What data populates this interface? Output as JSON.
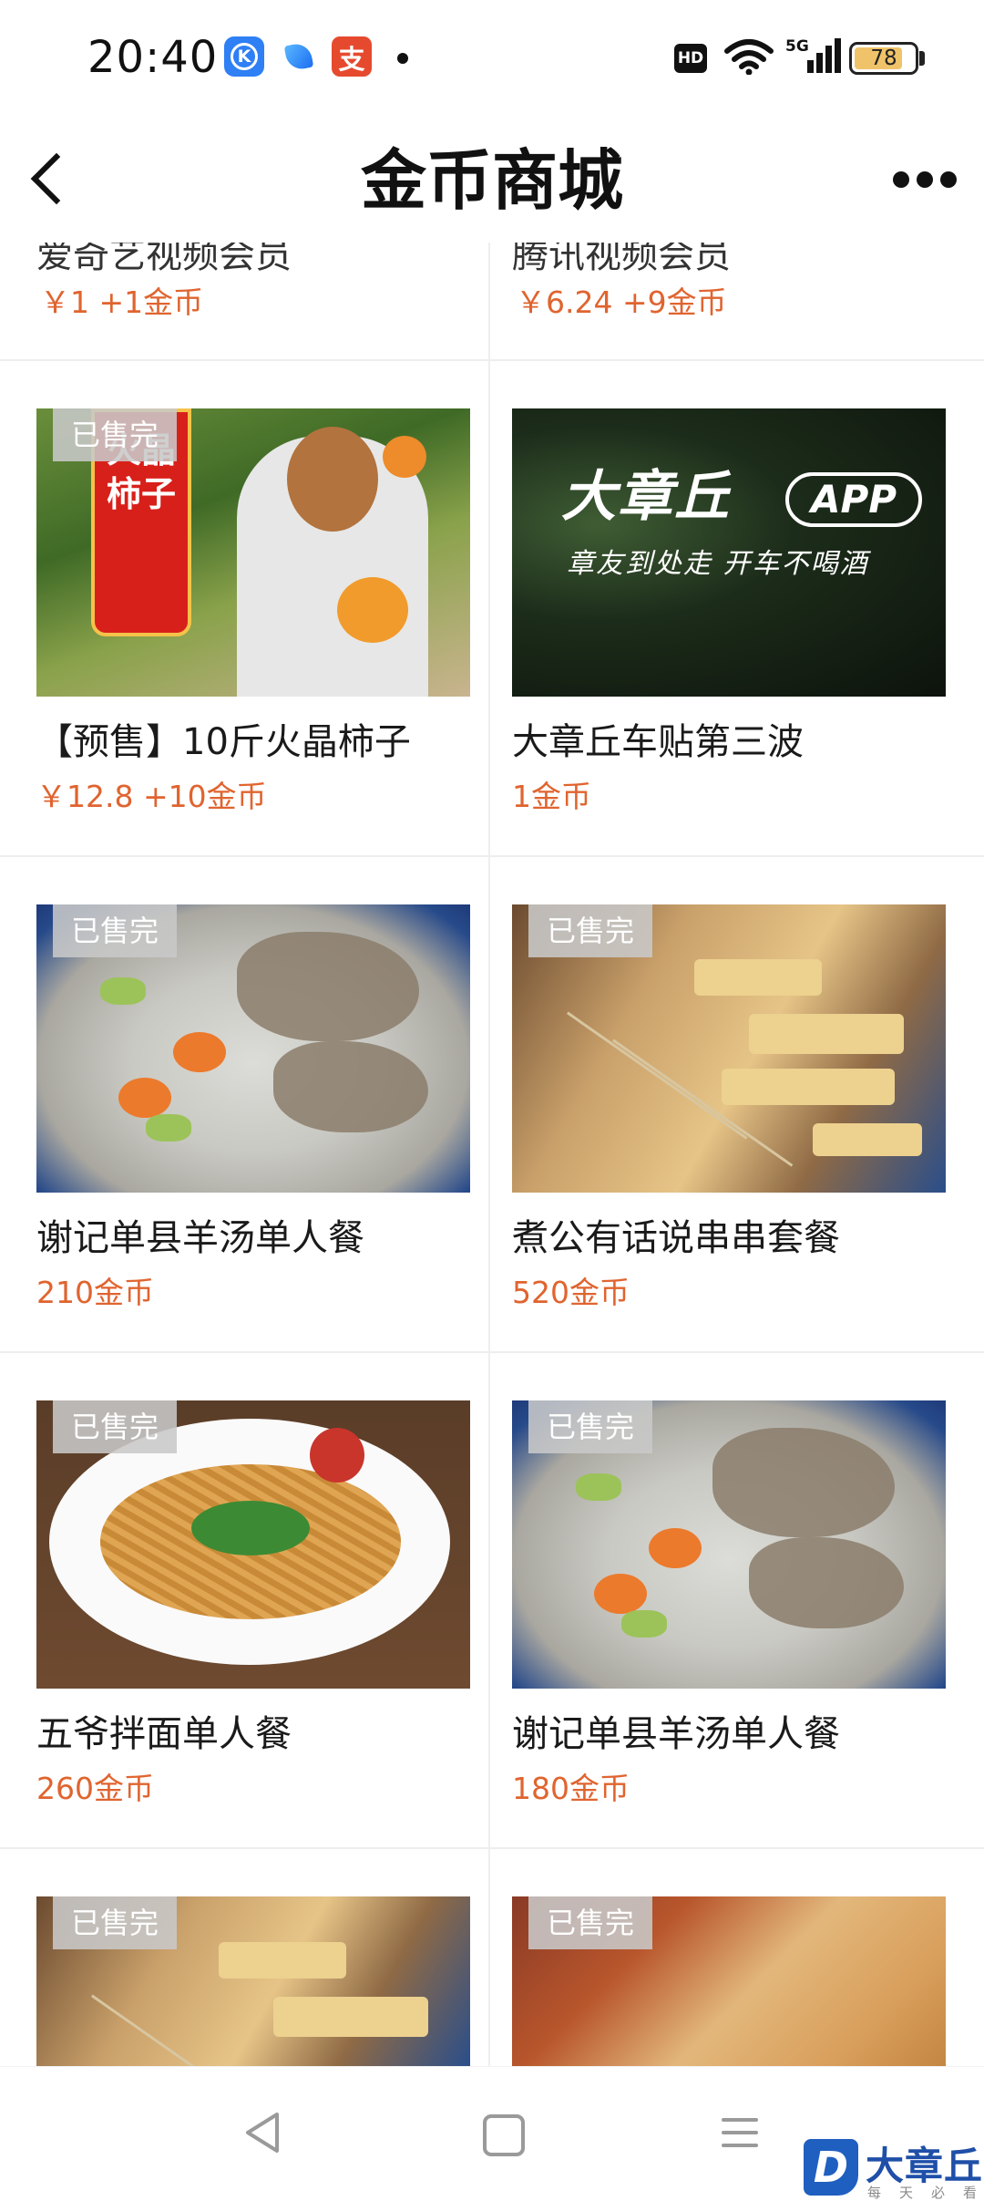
{
  "status_bar": {
    "time": "20:40",
    "apps": [
      "k-icon",
      "feather-icon",
      "alipay-icon"
    ],
    "alipay_glyph": "支",
    "k_glyph": "K",
    "hd_label": "HD",
    "network": "5G",
    "battery_level": "78"
  },
  "nav": {
    "title": "金币商城",
    "back_icon": "back-arrow-icon",
    "more_icon": "more-dots-icon"
  },
  "sold_out_label": "已售完",
  "partial_row": [
    {
      "title": "爱奇艺视频会员",
      "price": "￥1 +1金币"
    },
    {
      "title": "腾讯视频会员",
      "price": "￥6.24 +9金币"
    }
  ],
  "products": [
    {
      "title": "【预售】10斤火晶柿子",
      "price": "￥12.8 +10金币",
      "sold_out": true,
      "image": "persimmon",
      "banner_text": "火晶柿子"
    },
    {
      "title": "大章丘车贴第三波",
      "price": "1金币",
      "sold_out": false,
      "image": "car",
      "logo_text": "大章丘",
      "logo_app": "APP",
      "slogan": "章友到处走  开车不喝酒"
    },
    {
      "title": "谢记单县羊汤单人餐",
      "price": "210金币",
      "sold_out": true,
      "image": "soup"
    },
    {
      "title": "煮公有话说串串套餐",
      "price": "520金币",
      "sold_out": true,
      "image": "skewer"
    },
    {
      "title": "五爷拌面单人餐",
      "price": "260金币",
      "sold_out": true,
      "image": "noodle"
    },
    {
      "title": "谢记单县羊汤单人餐",
      "price": "180金币",
      "sold_out": true,
      "image": "soup"
    },
    {
      "title": "",
      "price": "",
      "sold_out": true,
      "image": "skewer"
    },
    {
      "title": "",
      "price": "",
      "sold_out": true,
      "image": "bread"
    }
  ],
  "system_nav": [
    "back-triangle-icon",
    "home-square-icon",
    "menu-lines-icon"
  ],
  "watermark": {
    "mark": "D",
    "name": "大章丘",
    "sub": "每天必看"
  },
  "colors": {
    "price": "#e0642f",
    "divider": "#eeeeee",
    "badge_bg": "#c8c8c8",
    "watermark_blue": "#1f5fc0"
  }
}
